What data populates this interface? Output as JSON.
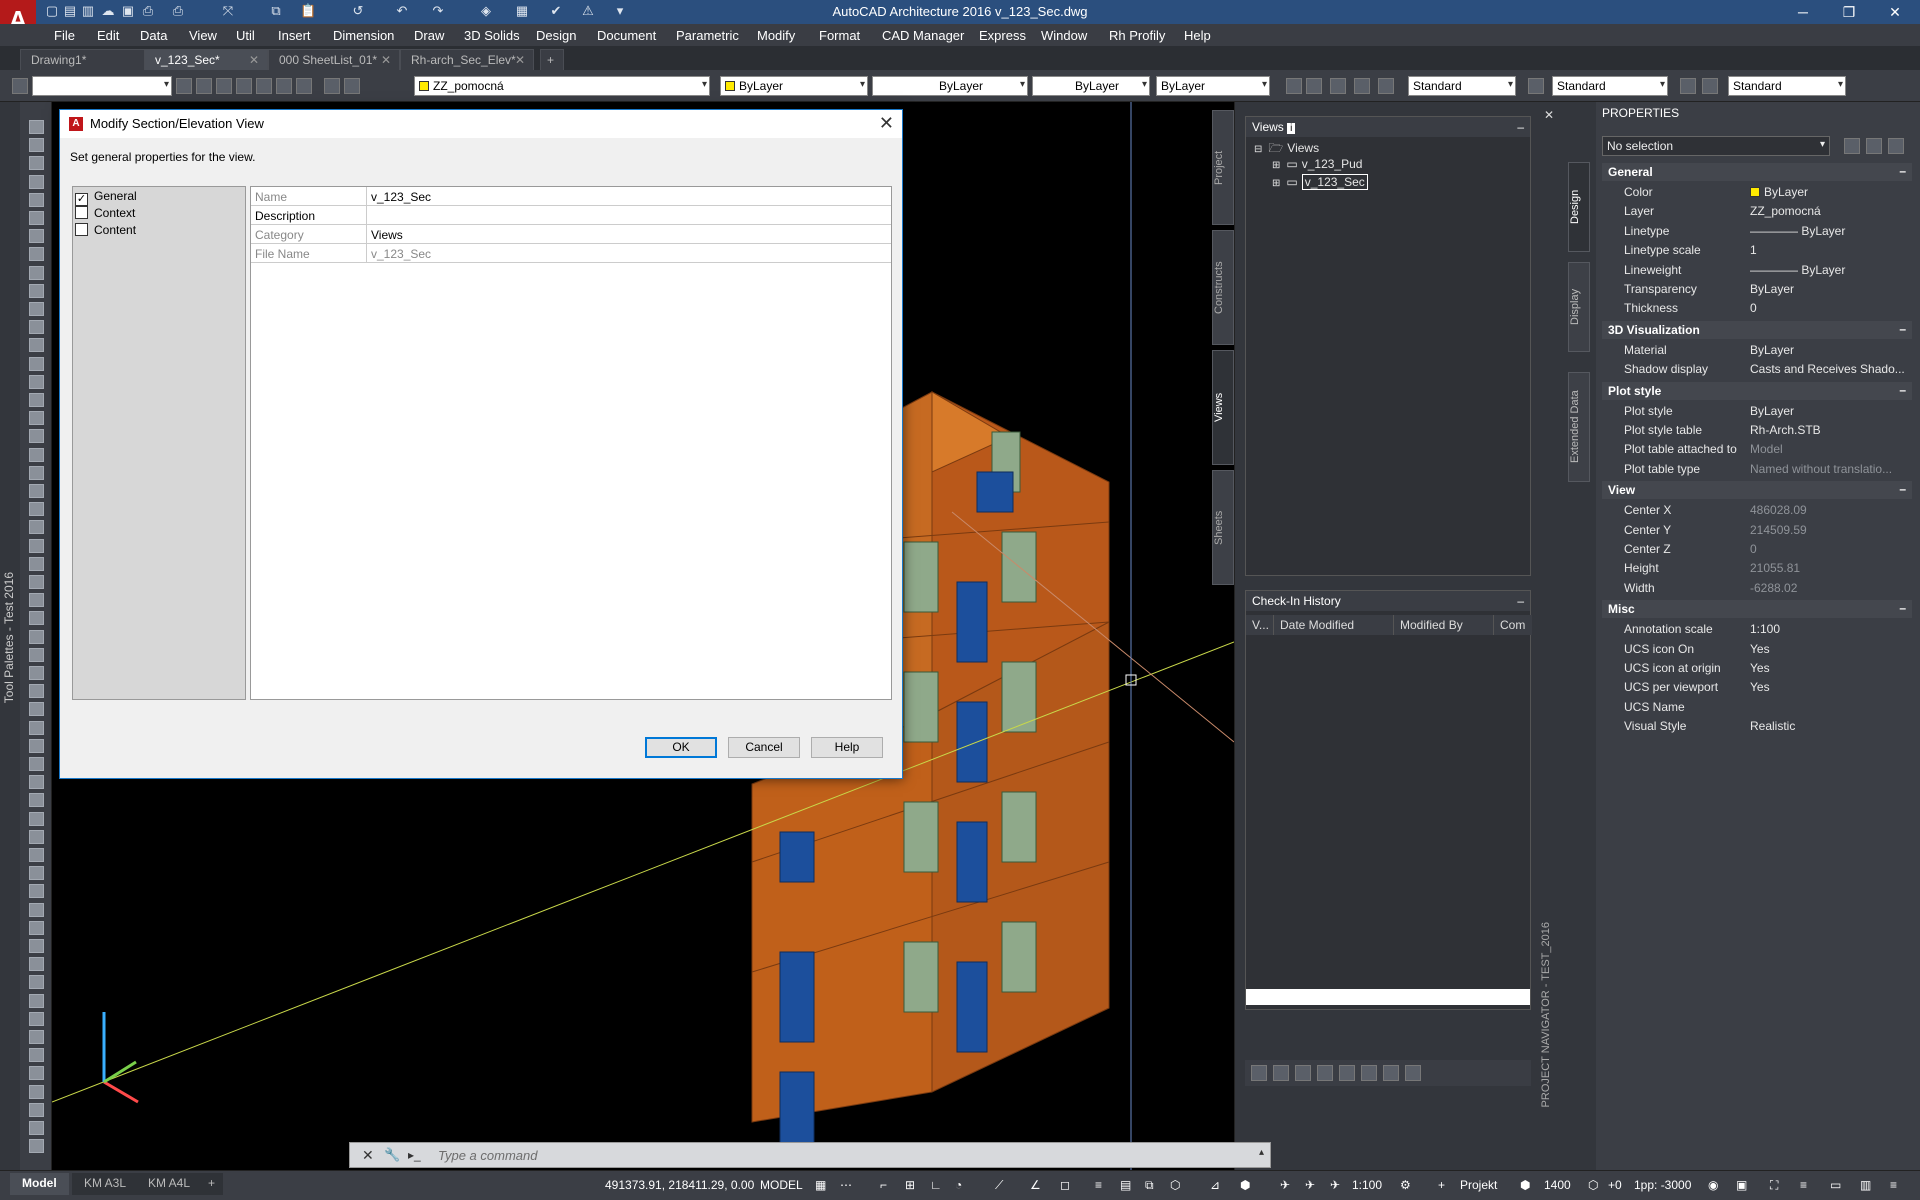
{
  "app": {
    "title": "AutoCAD Architecture 2016    v_123_Sec.dwg",
    "logo_letter": "A"
  },
  "menu": [
    "File",
    "Edit",
    "Data",
    "View",
    "Util",
    "Insert",
    "Dimension",
    "Draw",
    "3D Solids",
    "Design",
    "Document",
    "Parametric",
    "Modify",
    "Format",
    "CAD Manager",
    "Express",
    "Window",
    "Rh Profily",
    "Help"
  ],
  "tabs": [
    {
      "label": "Drawing1*"
    },
    {
      "label": "v_123_Sec*"
    },
    {
      "label": "000 SheetList_01*"
    },
    {
      "label": "Rh-arch_Sec_Elev*"
    }
  ],
  "toolbar": {
    "layer": "ZZ_pomocná",
    "color": "ByLayer",
    "linetype": "ByLayer",
    "lineweight": "ByLayer",
    "plotstyle": "ByLayer",
    "textstyle": "Standard",
    "dimstyle": "Standard",
    "tablestyle": "Standard"
  },
  "left_palette_label": "Tool Palettes - Test 2016",
  "dialog": {
    "title": "Modify Section/Elevation View",
    "subtitle": "Set general properties for the view.",
    "categories": [
      {
        "label": "General",
        "checked": "✓"
      },
      {
        "label": "Context",
        "checked": ""
      },
      {
        "label": "Content",
        "checked": ""
      }
    ],
    "fields": [
      {
        "label": "Name",
        "value": "v_123_Sec"
      },
      {
        "label": "Description",
        "value": ""
      },
      {
        "label": "Category",
        "value": "Views"
      },
      {
        "label": "File Name",
        "value": "v_123_Sec"
      }
    ],
    "ok": "OK",
    "cancel": "Cancel",
    "help": "Help"
  },
  "project_navigator": {
    "tabs": [
      "Project",
      "Constructs",
      "Views",
      "Sheets"
    ],
    "views_title": "Views",
    "tree_root": "Views",
    "tree_items": [
      "v_123_Pud",
      "v_123_Sec"
    ],
    "checkin_title": "Check-In History",
    "checkin_columns": [
      "V...",
      "Date Modified",
      "Modified By",
      "Com"
    ],
    "vertical_label": "PROJECT NAVIGATOR - TEST_2016"
  },
  "properties": {
    "title": "PROPERTIES",
    "selection": "No selection",
    "side_tabs": [
      "Design",
      "Display",
      "Extended Data"
    ],
    "sections": [
      {
        "name": "General",
        "rows": [
          {
            "k": "Color",
            "v": "ByLayer"
          },
          {
            "k": "Layer",
            "v": "ZZ_pomocná"
          },
          {
            "k": "Linetype",
            "v": "———— ByLayer"
          },
          {
            "k": "Linetype scale",
            "v": "1"
          },
          {
            "k": "Lineweight",
            "v": "———— ByLayer"
          },
          {
            "k": "Transparency",
            "v": "ByLayer"
          },
          {
            "k": "Thickness",
            "v": "0"
          }
        ]
      },
      {
        "name": "3D Visualization",
        "rows": [
          {
            "k": "Material",
            "v": "ByLayer"
          },
          {
            "k": "Shadow display",
            "v": "Casts and Receives Shado..."
          }
        ]
      },
      {
        "name": "Plot style",
        "rows": [
          {
            "k": "Plot style",
            "v": "ByLayer"
          },
          {
            "k": "Plot style table",
            "v": "Rh-Arch.STB"
          },
          {
            "k": "Plot table attached to",
            "v": "Model"
          },
          {
            "k": "Plot table type",
            "v": "Named without translatio..."
          }
        ]
      },
      {
        "name": "View",
        "rows": [
          {
            "k": "Center X",
            "v": "486028.09"
          },
          {
            "k": "Center Y",
            "v": "214509.59"
          },
          {
            "k": "Center Z",
            "v": "0"
          },
          {
            "k": "Height",
            "v": "21055.81"
          },
          {
            "k": "Width",
            "v": "-6288.02"
          }
        ]
      },
      {
        "name": "Misc",
        "rows": [
          {
            "k": "Annotation scale",
            "v": "1:100"
          },
          {
            "k": "UCS icon On",
            "v": "Yes"
          },
          {
            "k": "UCS icon at origin",
            "v": "Yes"
          },
          {
            "k": "UCS per viewport",
            "v": "Yes"
          },
          {
            "k": "UCS Name",
            "v": ""
          },
          {
            "k": "Visual Style",
            "v": "Realistic"
          }
        ]
      }
    ]
  },
  "command_line": {
    "placeholder": "Type a command"
  },
  "statusbar": {
    "layout_tabs": [
      "Model",
      "KM A3L",
      "KM A4L"
    ],
    "coords": "491373.91, 218411.29, 0.00",
    "mode": "MODEL",
    "scale": "1:100",
    "project": "Projekt",
    "number": "1400",
    "offset": "+0",
    "lpp": "1pp: -3000"
  },
  "colors": {
    "accent": "#1979ca",
    "brand": "#b41a1a",
    "building": "#c0601a",
    "window_blue": "#1c4f9c"
  }
}
